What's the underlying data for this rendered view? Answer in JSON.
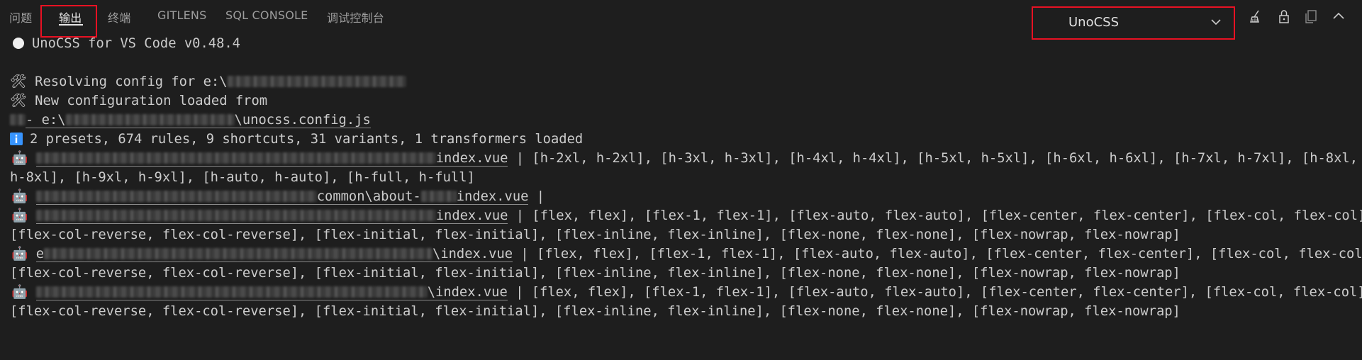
{
  "panel": {
    "tabs": [
      "问题",
      "输出",
      "终端",
      "GITLENS",
      "SQL CONSOLE",
      "调试控制台"
    ],
    "active_tab": "输出",
    "channel_select": "UnoCSS"
  },
  "icons": {
    "clear": "clear-output-icon",
    "lock": "lock-scroll-icon",
    "copy": "open-editor-icon",
    "collapse": "chevron-up-icon",
    "close": "close-icon",
    "select": "chevron-down-icon"
  },
  "colors": {
    "highlight": "#e81123",
    "info": "#3794ff",
    "background": "#1e1e1e"
  },
  "output": {
    "header": "UnoCSS for VS Code v0.48.4",
    "resolving": "Resolving config for e:\\",
    "loaded": "New configuration loaded from",
    "config_prefix": "- e:\\",
    "config_file": "\\unocss.config.js",
    "summary": "2 presets, 674 rules, 9 shortcuts, 31 variants, 1 transformers loaded",
    "file1": "index.vue",
    "file1_matches_a": " | [h-2xl, h-2xl], [h-3xl, h-3xl], [h-4xl, h-4xl], [h-5xl, h-5xl], [h-6xl, h-6xl], [h-7xl, h-7xl], [h-8xl,",
    "file1_matches_b": "h-8xl], [h-9xl, h-9xl], [h-auto, h-auto], [h-full, h-full]",
    "file2_mid": "common\\about-",
    "file2": "index.vue",
    "file2_matches": " |",
    "file3": "index.vue",
    "flex_a": " | [flex, flex], [flex-1, flex-1], [flex-auto, flex-auto], [flex-center, flex-center], [flex-col, flex-col],",
    "flex_b": "[flex-col-reverse, flex-col-reverse], [flex-initial, flex-initial], [flex-inline, flex-inline], [flex-none, flex-none], [flex-nowrap, flex-nowrap]",
    "file4_prefix": "e",
    "file4": "\\index.vue",
    "file5": "\\index.vue"
  }
}
